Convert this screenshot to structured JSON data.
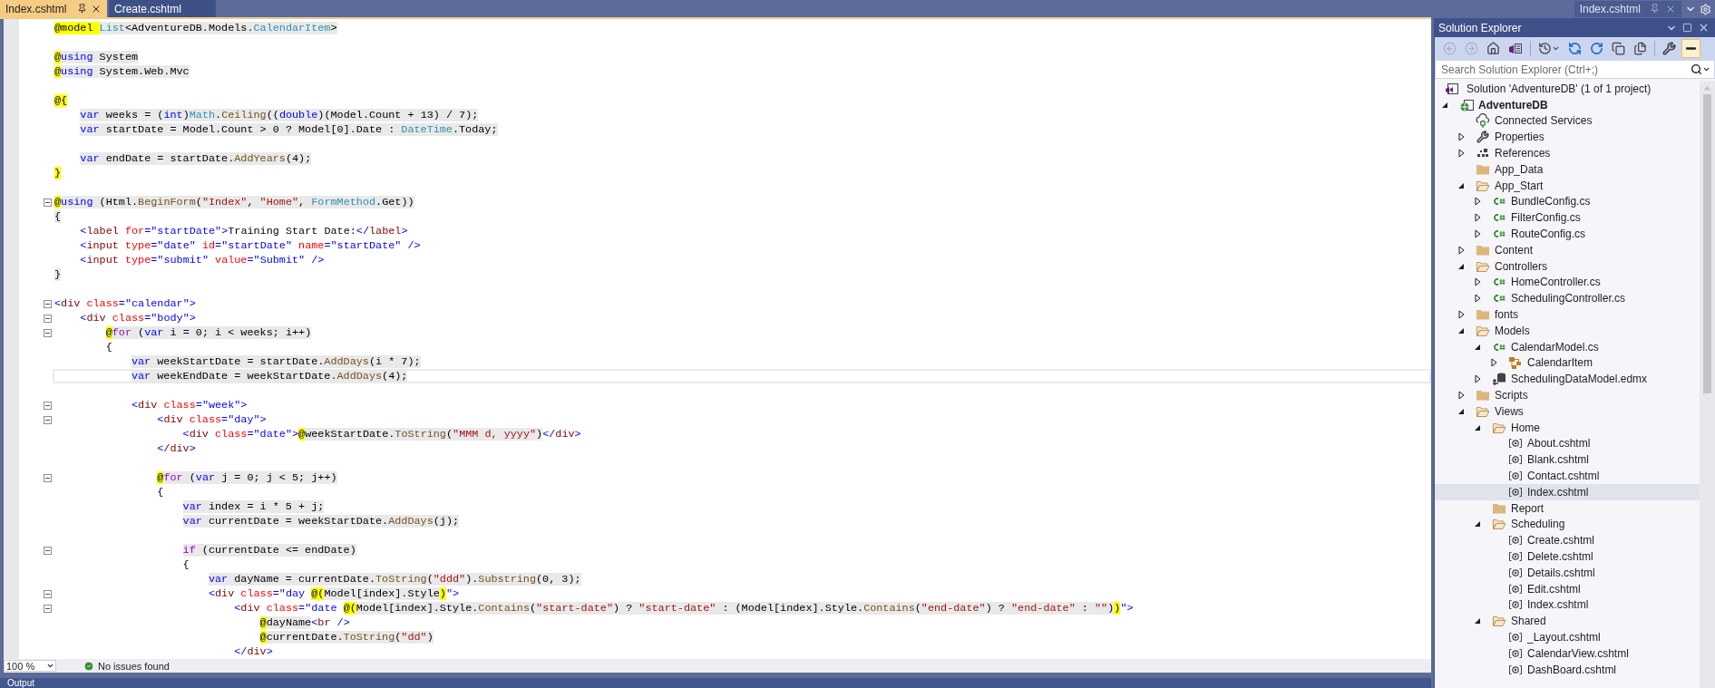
{
  "tabs": [
    {
      "label": "Index.cshtml",
      "selected": true
    },
    {
      "label": "Create.cshtml",
      "selected": false
    }
  ],
  "editor": {
    "lines": [
      {
        "collapsible": false,
        "current": false,
        "tokens": [
          {
            "text": "@model ",
            "kind": "razor"
          },
          {
            "text": "List",
            "kind": "type",
            "shaded": true
          },
          {
            "text": "<AdventureDB.Models.",
            "kind": "plain",
            "shaded": true
          },
          {
            "text": "CalendarItem",
            "kind": "type",
            "shaded": true
          },
          {
            "text": ">",
            "kind": "plain",
            "shaded": true
          }
        ]
      },
      {
        "collapsible": false,
        "current": false
      },
      {
        "collapsible": false,
        "current": false,
        "tokens": [
          {
            "text": "@",
            "kind": "razor"
          },
          {
            "text": "using",
            "kind": "keyword",
            "shaded": true
          },
          {
            "text": " System",
            "kind": "plain",
            "shaded": true
          }
        ]
      },
      {
        "collapsible": false,
        "current": false,
        "tokens": [
          {
            "text": "@",
            "kind": "razor"
          },
          {
            "text": "using",
            "kind": "keyword",
            "shaded": true
          },
          {
            "text": " System.Web.Mvc",
            "kind": "plain",
            "shaded": true
          }
        ]
      },
      {
        "collapsible": false,
        "current": false
      },
      {
        "collapsible": false,
        "current": false,
        "tokens": [
          {
            "text": "@{",
            "kind": "razor"
          }
        ]
      },
      {
        "collapsible": false,
        "current": false,
        "tokens": [
          {
            "text": "    var",
            "kind": "keyword",
            "shaded": true
          },
          {
            "text": " weeks = (",
            "kind": "plain",
            "shaded": true
          },
          {
            "text": "int",
            "kind": "keyword",
            "shaded": true
          },
          {
            "text": ")",
            "kind": "plain",
            "shaded": true
          },
          {
            "text": "Math",
            "kind": "type",
            "shaded": true
          },
          {
            "text": ".",
            "kind": "plain",
            "shaded": true
          },
          {
            "text": "Ceiling",
            "kind": "method",
            "shaded": true
          },
          {
            "text": "((",
            "kind": "plain",
            "shaded": true
          },
          {
            "text": "double",
            "kind": "keyword",
            "shaded": true
          },
          {
            "text": ")(Model.Count + 13) / 7);",
            "kind": "plain",
            "shaded": true
          }
        ]
      },
      {
        "collapsible": false,
        "current": false,
        "tokens": [
          {
            "text": "    var",
            "kind": "keyword",
            "shaded": true
          },
          {
            "text": " startDate = Model.Count > 0 ? Model[0].Date : ",
            "kind": "plain",
            "shaded": true
          },
          {
            "text": "DateTime",
            "kind": "type",
            "shaded": true
          },
          {
            "text": ".Today;",
            "kind": "plain",
            "shaded": true
          }
        ]
      },
      {
        "collapsible": false,
        "current": false
      },
      {
        "collapsible": false,
        "current": false,
        "tokens": [
          {
            "text": "    var",
            "kind": "keyword",
            "shaded": true
          },
          {
            "text": " endDate = startDate.",
            "kind": "plain",
            "shaded": true
          },
          {
            "text": "AddYears",
            "kind": "method",
            "shaded": true
          },
          {
            "text": "(4);",
            "kind": "plain",
            "shaded": true
          }
        ]
      },
      {
        "collapsible": false,
        "current": false,
        "tokens": [
          {
            "text": "}",
            "kind": "razor"
          }
        ]
      },
      {
        "collapsible": false,
        "current": false
      },
      {
        "collapsible": true,
        "current": false,
        "tokens": [
          {
            "text": "@",
            "kind": "razor"
          },
          {
            "text": "using",
            "kind": "keyword",
            "shaded": true
          },
          {
            "text": " (Html.",
            "kind": "plain",
            "shaded": true
          },
          {
            "text": "BeginForm",
            "kind": "method",
            "shaded": true
          },
          {
            "text": "(",
            "kind": "plain",
            "shaded": true
          },
          {
            "text": "\"Index\"",
            "kind": "string",
            "shaded": true
          },
          {
            "text": ", ",
            "kind": "plain",
            "shaded": true
          },
          {
            "text": "\"Home\"",
            "kind": "string",
            "shaded": true
          },
          {
            "text": ", ",
            "kind": "plain",
            "shaded": true
          },
          {
            "text": "FormMethod",
            "kind": "type",
            "shaded": true
          },
          {
            "text": ".Get))",
            "kind": "plain",
            "shaded": true
          }
        ]
      },
      {
        "collapsible": false,
        "current": false,
        "tokens": [
          {
            "text": "{",
            "kind": "plain",
            "shaded": true
          }
        ]
      },
      {
        "collapsible": false,
        "current": false,
        "tokens": [
          {
            "text": "    <",
            "kind": "delimiter",
            "shaded": false
          },
          {
            "text": "label",
            "kind": "element",
            "shaded": false
          },
          {
            "text": " for",
            "kind": "attribute",
            "shaded": false
          },
          {
            "text": "=",
            "kind": "delimiter",
            "shaded": false
          },
          {
            "text": "\"startDate\"",
            "kind": "value",
            "shaded": false
          },
          {
            "text": ">",
            "kind": "delimiter",
            "shaded": false
          },
          {
            "text": "Training Start Date:",
            "kind": "plain",
            "shaded": false
          },
          {
            "text": "</",
            "kind": "delimiter",
            "shaded": false
          },
          {
            "text": "label",
            "kind": "element",
            "shaded": false
          },
          {
            "text": ">",
            "kind": "delimiter",
            "shaded": false
          }
        ]
      },
      {
        "collapsible": false,
        "current": false,
        "tokens": [
          {
            "text": "    <",
            "kind": "delimiter",
            "shaded": false
          },
          {
            "text": "input",
            "kind": "element",
            "shaded": false
          },
          {
            "text": " type",
            "kind": "attribute",
            "shaded": false
          },
          {
            "text": "=",
            "kind": "delimiter",
            "shaded": false
          },
          {
            "text": "\"date\"",
            "kind": "value",
            "shaded": false
          },
          {
            "text": " id",
            "kind": "attribute",
            "shaded": false
          },
          {
            "text": "=",
            "kind": "delimiter",
            "shaded": false
          },
          {
            "text": "\"startDate\"",
            "kind": "value",
            "shaded": false
          },
          {
            "text": " name",
            "kind": "attribute",
            "shaded": false
          },
          {
            "text": "=",
            "kind": "delimiter",
            "shaded": false
          },
          {
            "text": "\"startDate\"",
            "kind": "value",
            "shaded": false
          },
          {
            "text": " />",
            "kind": "delimiter",
            "shaded": false
          }
        ]
      },
      {
        "collapsible": false,
        "current": false,
        "tokens": [
          {
            "text": "    <",
            "kind": "delimiter",
            "shaded": false
          },
          {
            "text": "input",
            "kind": "element",
            "shaded": false
          },
          {
            "text": " type",
            "kind": "attribute",
            "shaded": false
          },
          {
            "text": "=",
            "kind": "delimiter",
            "shaded": false
          },
          {
            "text": "\"submit\"",
            "kind": "value",
            "shaded": false
          },
          {
            "text": " value",
            "kind": "attribute",
            "shaded": false
          },
          {
            "text": "=",
            "kind": "delimiter",
            "shaded": false
          },
          {
            "text": "\"Submit\"",
            "kind": "value",
            "shaded": false
          },
          {
            "text": " />",
            "kind": "delimiter",
            "shaded": false
          }
        ]
      },
      {
        "collapsible": false,
        "current": false,
        "tokens": [
          {
            "text": "}",
            "kind": "plain",
            "shaded": true
          }
        ]
      },
      {
        "collapsible": false,
        "current": false
      },
      {
        "collapsible": true,
        "current": false,
        "tokens": [
          {
            "text": "<",
            "kind": "delimiter",
            "shaded": false
          },
          {
            "text": "div",
            "kind": "element",
            "shaded": false
          },
          {
            "text": " class",
            "kind": "attribute",
            "shaded": false
          },
          {
            "text": "=",
            "kind": "delimiter",
            "shaded": false
          },
          {
            "text": "\"calendar\"",
            "kind": "value",
            "shaded": false
          },
          {
            "text": ">",
            "kind": "delimiter",
            "shaded": false
          }
        ]
      },
      {
        "collapsible": true,
        "current": false,
        "tokens": [
          {
            "text": "    <",
            "kind": "delimiter",
            "shaded": false
          },
          {
            "text": "div",
            "kind": "element",
            "shaded": false
          },
          {
            "text": " class",
            "kind": "attribute",
            "shaded": false
          },
          {
            "text": "=",
            "kind": "delimiter",
            "shaded": false
          },
          {
            "text": "\"body\"",
            "kind": "value",
            "shaded": false
          },
          {
            "text": ">",
            "kind": "delimiter",
            "shaded": false
          }
        ]
      },
      {
        "collapsible": true,
        "current": false,
        "tokens": [
          {
            "text": "        @",
            "kind": "razor"
          },
          {
            "text": "for",
            "kind": "control",
            "shaded": true
          },
          {
            "text": " (",
            "kind": "plain",
            "shaded": true
          },
          {
            "text": "var",
            "kind": "keyword",
            "shaded": true
          },
          {
            "text": " i = 0; i < weeks; i++)",
            "kind": "plain",
            "shaded": true
          }
        ]
      },
      {
        "collapsible": false,
        "current": false,
        "tokens": [
          {
            "text": "        {",
            "kind": "plain",
            "shaded": false
          }
        ]
      },
      {
        "collapsible": false,
        "current": false,
        "tokens": [
          {
            "text": "            var",
            "kind": "keyword",
            "shaded": true
          },
          {
            "text": " weekStartDate = startDate.",
            "kind": "plain",
            "shaded": true
          },
          {
            "text": "AddDays",
            "kind": "method",
            "shaded": true
          },
          {
            "text": "(i * 7);",
            "kind": "plain",
            "shaded": true
          }
        ]
      },
      {
        "collapsible": false,
        "current": true,
        "tokens": [
          {
            "text": "            var",
            "kind": "keyword",
            "shaded": true
          },
          {
            "text": " weekEndDate = weekStartDate.",
            "kind": "plain",
            "shaded": true
          },
          {
            "text": "AddDays",
            "kind": "method",
            "shaded": true
          },
          {
            "text": "(4);",
            "kind": "plain",
            "shaded": true
          }
        ]
      },
      {
        "collapsible": false,
        "current": false
      },
      {
        "collapsible": true,
        "current": false,
        "tokens": [
          {
            "text": "            <",
            "kind": "delimiter",
            "shaded": false
          },
          {
            "text": "div",
            "kind": "element",
            "shaded": false
          },
          {
            "text": " class",
            "kind": "attribute",
            "shaded": false
          },
          {
            "text": "=",
            "kind": "delimiter",
            "shaded": false
          },
          {
            "text": "\"week\"",
            "kind": "value",
            "shaded": false
          },
          {
            "text": ">",
            "kind": "delimiter",
            "shaded": false
          }
        ]
      },
      {
        "collapsible": true,
        "current": false,
        "tokens": [
          {
            "text": "                <",
            "kind": "delimiter",
            "shaded": false
          },
          {
            "text": "div",
            "kind": "element",
            "shaded": false
          },
          {
            "text": " class",
            "kind": "attribute",
            "shaded": false
          },
          {
            "text": "=",
            "kind": "delimiter",
            "shaded": false
          },
          {
            "text": "\"day\"",
            "kind": "value",
            "shaded": false
          },
          {
            "text": ">",
            "kind": "delimiter",
            "shaded": false
          }
        ]
      },
      {
        "collapsible": false,
        "current": false,
        "tokens": [
          {
            "text": "                    <",
            "kind": "delimiter",
            "shaded": false
          },
          {
            "text": "div",
            "kind": "element",
            "shaded": false
          },
          {
            "text": " class",
            "kind": "attribute",
            "shaded": false
          },
          {
            "text": "=",
            "kind": "delimiter",
            "shaded": false
          },
          {
            "text": "\"date\"",
            "kind": "value",
            "shaded": false
          },
          {
            "text": ">",
            "kind": "delimiter",
            "shaded": false
          },
          {
            "text": "@",
            "kind": "razor"
          },
          {
            "text": "weekStartDate.",
            "kind": "plain",
            "shaded": true
          },
          {
            "text": "ToString",
            "kind": "method",
            "shaded": true
          },
          {
            "text": "(",
            "kind": "plain",
            "shaded": true
          },
          {
            "text": "\"MMM d, yyyy\"",
            "kind": "string",
            "shaded": true
          },
          {
            "text": ")",
            "kind": "plain",
            "shaded": true
          },
          {
            "text": "</",
            "kind": "delimiter",
            "shaded": false
          },
          {
            "text": "div",
            "kind": "element",
            "shaded": false
          },
          {
            "text": ">",
            "kind": "delimiter",
            "shaded": false
          }
        ]
      },
      {
        "collapsible": false,
        "current": false,
        "tokens": [
          {
            "text": "                </",
            "kind": "delimiter",
            "shaded": false
          },
          {
            "text": "div",
            "kind": "element",
            "shaded": false
          },
          {
            "text": ">",
            "kind": "delimiter",
            "shaded": false
          }
        ]
      },
      {
        "collapsible": false,
        "current": false
      },
      {
        "collapsible": true,
        "current": false,
        "tokens": [
          {
            "text": "                @",
            "kind": "razor"
          },
          {
            "text": "for",
            "kind": "control",
            "shaded": true
          },
          {
            "text": " (",
            "kind": "plain",
            "shaded": true
          },
          {
            "text": "var",
            "kind": "keyword",
            "shaded": true
          },
          {
            "text": " j = 0; j < 5; j++)",
            "kind": "plain",
            "shaded": true
          }
        ]
      },
      {
        "collapsible": false,
        "current": false,
        "tokens": [
          {
            "text": "                {",
            "kind": "plain",
            "shaded": false
          }
        ]
      },
      {
        "collapsible": false,
        "current": false,
        "tokens": [
          {
            "text": "                    var",
            "kind": "keyword",
            "shaded": true
          },
          {
            "text": " index = i * 5 + j;",
            "kind": "plain",
            "shaded": true
          }
        ]
      },
      {
        "collapsible": false,
        "current": false,
        "tokens": [
          {
            "text": "                    var",
            "kind": "keyword",
            "shaded": true
          },
          {
            "text": " currentDate = weekStartDate.",
            "kind": "plain",
            "shaded": true
          },
          {
            "text": "AddDays",
            "kind": "method",
            "shaded": true
          },
          {
            "text": "(j);",
            "kind": "plain",
            "shaded": true
          }
        ]
      },
      {
        "collapsible": false,
        "current": false
      },
      {
        "collapsible": true,
        "current": false,
        "tokens": [
          {
            "text": "                    if",
            "kind": "control",
            "shaded": true
          },
          {
            "text": " (currentDate <= endDate)",
            "kind": "plain",
            "shaded": true
          }
        ]
      },
      {
        "collapsible": false,
        "current": false,
        "tokens": [
          {
            "text": "                    {",
            "kind": "plain",
            "shaded": false
          }
        ]
      },
      {
        "collapsible": false,
        "current": false,
        "tokens": [
          {
            "text": "                        var",
            "kind": "keyword",
            "shaded": true
          },
          {
            "text": " dayName = currentDate.",
            "kind": "plain",
            "shaded": true
          },
          {
            "text": "ToString",
            "kind": "method",
            "shaded": true
          },
          {
            "text": "(",
            "kind": "plain",
            "shaded": true
          },
          {
            "text": "\"ddd\"",
            "kind": "string",
            "shaded": true
          },
          {
            "text": ").",
            "kind": "plain",
            "shaded": true
          },
          {
            "text": "Substring",
            "kind": "method",
            "shaded": true
          },
          {
            "text": "(0, 3);",
            "kind": "plain",
            "shaded": true
          }
        ]
      },
      {
        "collapsible": true,
        "current": false,
        "tokens": [
          {
            "text": "                        <",
            "kind": "delimiter",
            "shaded": false
          },
          {
            "text": "div",
            "kind": "element",
            "shaded": false
          },
          {
            "text": " class",
            "kind": "attribute",
            "shaded": false
          },
          {
            "text": "=",
            "kind": "delimiter",
            "shaded": false
          },
          {
            "text": "\"day ",
            "kind": "value",
            "shaded": false
          },
          {
            "text": "@(",
            "kind": "razor"
          },
          {
            "text": "Model[index].Style",
            "kind": "plain",
            "shaded": true
          },
          {
            "text": ")",
            "kind": "razor"
          },
          {
            "text": "\"",
            "kind": "value",
            "shaded": false
          },
          {
            "text": ">",
            "kind": "delimiter",
            "shaded": false
          }
        ]
      },
      {
        "collapsible": true,
        "current": false,
        "tokens": [
          {
            "text": "                            <",
            "kind": "delimiter",
            "shaded": false
          },
          {
            "text": "div",
            "kind": "element",
            "shaded": false
          },
          {
            "text": " class",
            "kind": "attribute",
            "shaded": false
          },
          {
            "text": "=",
            "kind": "delimiter",
            "shaded": false
          },
          {
            "text": "\"date ",
            "kind": "value",
            "shaded": false
          },
          {
            "text": "@(",
            "kind": "razor"
          },
          {
            "text": "Model[index].Style.",
            "kind": "plain",
            "shaded": true
          },
          {
            "text": "Contains",
            "kind": "method",
            "shaded": true
          },
          {
            "text": "(",
            "kind": "plain",
            "shaded": true
          },
          {
            "text": "\"start-date\"",
            "kind": "string",
            "shaded": true
          },
          {
            "text": ") ? ",
            "kind": "plain",
            "shaded": true
          },
          {
            "text": "\"start-date\"",
            "kind": "string",
            "shaded": true
          },
          {
            "text": " : (Model[index].Style.",
            "kind": "plain",
            "shaded": true
          },
          {
            "text": "Contains",
            "kind": "method",
            "shaded": true
          },
          {
            "text": "(",
            "kind": "plain",
            "shaded": true
          },
          {
            "text": "\"end-date\"",
            "kind": "string",
            "shaded": true
          },
          {
            "text": ") ? ",
            "kind": "plain",
            "shaded": true
          },
          {
            "text": "\"end-date\"",
            "kind": "string",
            "shaded": true
          },
          {
            "text": " : ",
            "kind": "plain",
            "shaded": true
          },
          {
            "text": "\"\"",
            "kind": "string",
            "shaded": true
          },
          {
            "text": ")",
            "kind": "plain",
            "shaded": true
          },
          {
            "text": ")",
            "kind": "razor"
          },
          {
            "text": "\"",
            "kind": "value",
            "shaded": false
          },
          {
            "text": ">",
            "kind": "delimiter",
            "shaded": false
          }
        ]
      },
      {
        "collapsible": false,
        "current": false,
        "tokens": [
          {
            "text": "                                @",
            "kind": "razor"
          },
          {
            "text": "dayName",
            "kind": "plain",
            "shaded": true
          },
          {
            "text": "<",
            "kind": "delimiter",
            "shaded": false
          },
          {
            "text": "br",
            "kind": "element",
            "shaded": false
          },
          {
            "text": " />",
            "kind": "delimiter",
            "shaded": false
          }
        ]
      },
      {
        "collapsible": false,
        "current": false,
        "tokens": [
          {
            "text": "                                @",
            "kind": "razor"
          },
          {
            "text": "currentDate.",
            "kind": "plain",
            "shaded": true
          },
          {
            "text": "ToString",
            "kind": "method",
            "shaded": true
          },
          {
            "text": "(",
            "kind": "plain",
            "shaded": true
          },
          {
            "text": "\"dd\"",
            "kind": "string",
            "shaded": true
          },
          {
            "text": ")",
            "kind": "plain",
            "shaded": true
          }
        ]
      },
      {
        "collapsible": false,
        "current": false,
        "tokens": [
          {
            "text": "                            </",
            "kind": "delimiter",
            "shaded": false
          },
          {
            "text": "div",
            "kind": "element",
            "shaded": false
          },
          {
            "text": ">",
            "kind": "delimiter",
            "shaded": false
          }
        ]
      }
    ]
  },
  "status_bar": {
    "zoom": "100 %",
    "message": "No issues found"
  },
  "output_panel": {
    "title": "Output"
  },
  "preview_tab": {
    "label": "Index.cshtml"
  },
  "solution_explorer": {
    "title": "Solution Explorer",
    "toolbar": [
      {
        "kind": "back",
        "disabled": true,
        "on": false
      },
      {
        "kind": "forward",
        "disabled": true,
        "on": false
      },
      {
        "kind": "home",
        "disabled": false,
        "on": false
      },
      {
        "kind": "switch_views",
        "disabled": false,
        "on": false
      },
      {
        "kind": "pending_filter",
        "disabled": false,
        "on": false
      },
      {
        "kind": "sync",
        "disabled": false,
        "on": false
      },
      {
        "kind": "refresh",
        "disabled": false,
        "on": false
      },
      {
        "kind": "collapse_all",
        "disabled": false,
        "on": false
      },
      {
        "kind": "show_all_files",
        "disabled": false,
        "on": false
      },
      {
        "kind": "properties",
        "disabled": false,
        "on": false
      },
      {
        "kind": "preview",
        "disabled": false,
        "on": true
      }
    ],
    "search": {
      "placeholder": "Search Solution Explorer (Ctrl+;)"
    },
    "solution": {
      "label": "Solution 'AdventureDB' (1 of 1 project)"
    },
    "tree": [
      {
        "label": "AdventureDB",
        "kind": "project",
        "expanded": true,
        "selected": false,
        "children": [
          {
            "label": "Connected Services",
            "kind": "service",
            "selected": false
          },
          {
            "label": "Properties",
            "kind": "properties",
            "expanded": false,
            "selected": false
          },
          {
            "label": "References",
            "kind": "references",
            "expanded": false,
            "selected": false
          },
          {
            "label": "App_Data",
            "kind": "folder",
            "selected": false
          },
          {
            "label": "App_Start",
            "kind": "folder",
            "expanded": true,
            "selected": false,
            "children": [
              {
                "label": "BundleConfig.cs",
                "kind": "cs",
                "expanded": false,
                "selected": false
              },
              {
                "label": "FilterConfig.cs",
                "kind": "cs",
                "expanded": false,
                "selected": false
              },
              {
                "label": "RouteConfig.cs",
                "kind": "cs",
                "expanded": false,
                "selected": false
              }
            ]
          },
          {
            "label": "Content",
            "kind": "folder",
            "expanded": false,
            "selected": false
          },
          {
            "label": "Controllers",
            "kind": "folder",
            "expanded": true,
            "selected": false,
            "children": [
              {
                "label": "HomeController.cs",
                "kind": "cs",
                "expanded": false,
                "selected": false
              },
              {
                "label": "SchedulingController.cs",
                "kind": "cs",
                "expanded": false,
                "selected": false
              }
            ]
          },
          {
            "label": "fonts",
            "kind": "folder",
            "expanded": false,
            "selected": false
          },
          {
            "label": "Models",
            "kind": "folder",
            "expanded": true,
            "selected": false,
            "children": [
              {
                "label": "CalendarModel.cs",
                "kind": "cs",
                "expanded": true,
                "selected": false,
                "children": [
                  {
                    "label": "CalendarItem",
                    "kind": "class",
                    "expanded": false,
                    "selected": false
                  }
                ]
              },
              {
                "label": "SchedulingDataModel.edmx",
                "kind": "edmx",
                "expanded": false,
                "selected": false
              }
            ]
          },
          {
            "label": "Scripts",
            "kind": "folder",
            "expanded": false,
            "selected": false
          },
          {
            "label": "Views",
            "kind": "folder",
            "expanded": true,
            "selected": false,
            "children": [
              {
                "label": "Home",
                "kind": "folder",
                "expanded": true,
                "selected": false,
                "children": [
                  {
                    "label": "About.cshtml",
                    "kind": "cshtml",
                    "selected": false
                  },
                  {
                    "label": "Blank.cshtml",
                    "kind": "cshtml",
                    "selected": false
                  },
                  {
                    "label": "Contact.cshtml",
                    "kind": "cshtml",
                    "selected": false
                  },
                  {
                    "label": "Index.cshtml",
                    "kind": "cshtml",
                    "selected": true
                  }
                ]
              },
              {
                "label": "Report",
                "kind": "folder",
                "selected": false
              },
              {
                "label": "Scheduling",
                "kind": "folder",
                "expanded": true,
                "selected": false,
                "children": [
                  {
                    "label": "Create.cshtml",
                    "kind": "cshtml",
                    "selected": false
                  },
                  {
                    "label": "Delete.cshtml",
                    "kind": "cshtml",
                    "selected": false
                  },
                  {
                    "label": "Details.cshtml",
                    "kind": "cshtml",
                    "selected": false
                  },
                  {
                    "label": "Edit.cshtml",
                    "kind": "cshtml",
                    "selected": false
                  },
                  {
                    "label": "Index.cshtml",
                    "kind": "cshtml",
                    "selected": false
                  }
                ]
              },
              {
                "label": "Shared",
                "kind": "folder",
                "expanded": true,
                "selected": false,
                "children": [
                  {
                    "label": "_Layout.cshtml",
                    "kind": "cshtml",
                    "selected": false
                  },
                  {
                    "label": "CalendarView.cshtml",
                    "kind": "cshtml",
                    "selected": false
                  },
                  {
                    "label": "DashBoard.cshtml",
                    "kind": "cshtml",
                    "selected": false
                  }
                ]
              }
            ]
          }
        ]
      }
    ]
  }
}
